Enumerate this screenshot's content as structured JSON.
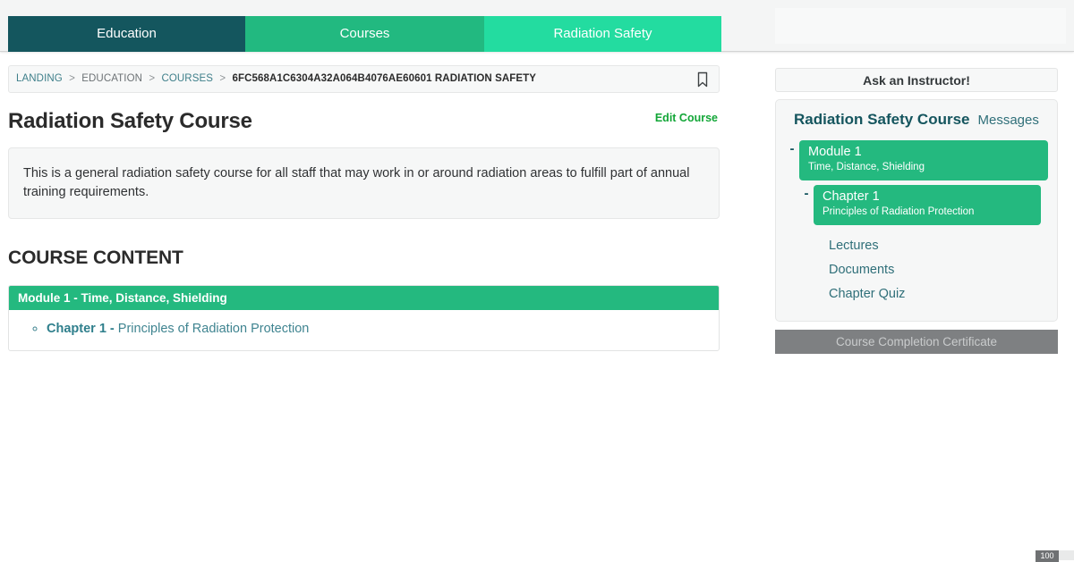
{
  "nav": {
    "tabs": [
      {
        "label": "Education",
        "color": "#14565e"
      },
      {
        "label": "Courses",
        "color": "#22b980"
      },
      {
        "label": "Radiation Safety",
        "color": "#23dca0"
      }
    ]
  },
  "breadcrumb": {
    "items": [
      {
        "label": "LANDING",
        "type": "link"
      },
      {
        "label": "EDUCATION",
        "type": "plain"
      },
      {
        "label": "COURSES",
        "type": "link"
      },
      {
        "label": "6FC568A1C6304A32A064B4076AE60601 RADIATION SAFETY",
        "type": "current"
      }
    ],
    "separator": ">",
    "bookmark_icon": "bookmark-icon"
  },
  "main": {
    "title": "Radiation Safety Course",
    "edit_link": "Edit Course",
    "description": "This is a general radiation safety course for all staff that may work in or around radiation areas to fulfill part of annual training requirements.",
    "section_heading": "COURSE CONTENT",
    "modules": [
      {
        "header": "Module 1 - Time, Distance, Shielding",
        "chapters": [
          {
            "number": "Chapter 1 -",
            "name": "Principles of Radiation Protection"
          }
        ]
      }
    ]
  },
  "sidebar": {
    "ask_button": "Ask an Instructor!",
    "tree_title": "Radiation Safety Course",
    "messages_link": "Messages",
    "toggle_symbol": "-",
    "module": {
      "title": "Module 1",
      "subtitle": "Time, Distance, Shielding"
    },
    "chapter": {
      "title": "Chapter 1",
      "subtitle": "Principles of Radiation Protection"
    },
    "sub_links": [
      "Lectures",
      "Documents",
      "Chapter Quiz"
    ],
    "certificate_button": "Course Completion Certificate"
  },
  "corner": {
    "badge": "100"
  },
  "colors": {
    "nav_active": "#14565e",
    "accent_green": "#24b97f",
    "accent_light_green": "#23dca0",
    "edit_link_green": "#12a637",
    "link_teal": "#2f6f79",
    "disabled_gray": "#7e8082"
  }
}
